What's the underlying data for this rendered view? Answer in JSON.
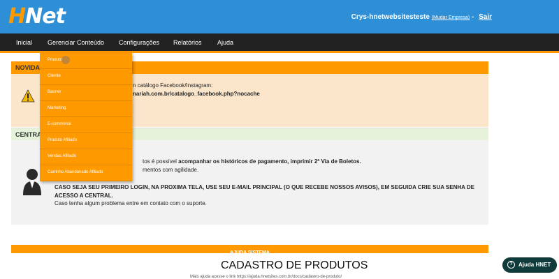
{
  "header": {
    "logo": {
      "h": "H",
      "rest": "Net"
    },
    "account_name": "Crys-hnetwebsitesteste",
    "change_company": "(Mudar Empresa)",
    "separator": "-",
    "exit": "Sair",
    "bg_color": "#2f8fd6",
    "accent_color": "#ff9900"
  },
  "nav": {
    "items": [
      "Inicial",
      "Gerenciar Conteúdo",
      "Configurações",
      "Relatórios",
      "Ajuda"
    ]
  },
  "dropdown": {
    "items": [
      "Produto",
      "Cliente",
      "Banner",
      "Marketing",
      "E-commerce",
      "Produto Afiliado",
      "Vendas Afiliado",
      "Carrinho Abandonado Afiliado"
    ]
  },
  "news": {
    "header": "NOVIDAD",
    "line1": "n catálogo Facebook/Instagram:",
    "line2": "nariah.com.br/catalogo_facebook.php?nocache",
    "icon": "warning-icon"
  },
  "central": {
    "header": "CENTRA",
    "line1_pre": "tos é possível ",
    "line1_bold": "acompanhar os históricos de pagamento, imprimir 2ª Via de Boletos.",
    "line2": "mentos com agilidade.",
    "line3": "CASO SEJA SEU PRIMEIRO LOGIN, NA PROXIMA TELA, USE SEU E-MAIL PRINCIPAL (O QUE RECEBE NOSSOS AVISOS), EM SEGUIDA CRIE SUA SENHA DE ACESSO A CENTRAL.",
    "line4": "Caso tenha algum problema entre em contato com o suporte.",
    "icon": "user-support-icon"
  },
  "help": {
    "bar": "AJUDA SISTEMA",
    "title": "CADASTRO DE PRODUTOS",
    "subtitle": "Mais ajuda acesse o link https://ajuda.hnetsites.com.br/docs/cadastro-de-produto/",
    "button": "Ajuda HNET",
    "button_icon": "question-icon"
  }
}
